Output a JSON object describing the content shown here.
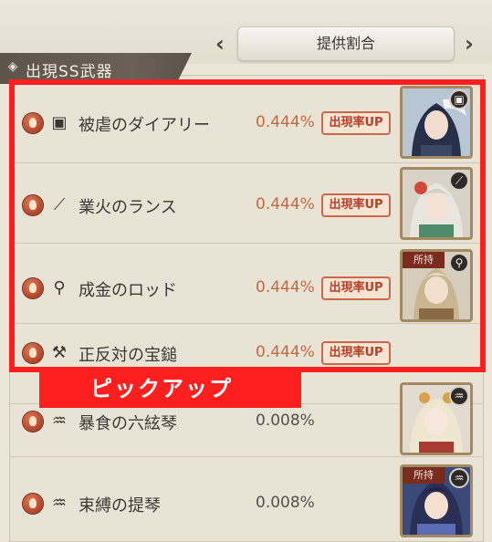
{
  "header": {
    "tab_label": "提供割合",
    "prev_icon": "chevron-left-icon",
    "next_icon": "chevron-right-icon"
  },
  "section": {
    "title": "出現SS武器",
    "icon": "diamond-icon"
  },
  "weapons": [
    {
      "name": "被虐のダイアリー",
      "rate": "0.444%",
      "badge": "出現率UP",
      "weapon_icon": "book-icon",
      "pickup": true,
      "portrait": true,
      "owned": false
    },
    {
      "name": "業火のランス",
      "rate": "0.444%",
      "badge": "出現率UP",
      "weapon_icon": "spear-icon",
      "pickup": true,
      "portrait": true,
      "owned": false
    },
    {
      "name": "成金のロッド",
      "rate": "0.444%",
      "badge": "出現率UP",
      "weapon_icon": "staff-icon",
      "pickup": true,
      "portrait": true,
      "owned": true
    },
    {
      "name": "正反対の宝鎚",
      "rate": "0.444%",
      "badge": "出現率UP",
      "weapon_icon": "hammer-icon",
      "pickup": true,
      "portrait": false,
      "owned": false
    },
    {
      "name": "暴食の六絃琴",
      "rate": "0.008%",
      "badge": "",
      "weapon_icon": "harp-icon",
      "pickup": false,
      "portrait": true,
      "owned": false
    },
    {
      "name": "束縛の提琴",
      "rate": "0.008%",
      "badge": "",
      "weapon_icon": "harp-icon",
      "pickup": false,
      "portrait": true,
      "owned": true
    }
  ],
  "owned_label": "所持",
  "pickup_label": "ピックアップ",
  "colors": {
    "highlight": "#ff1f1f",
    "rate_up": "#c06a44",
    "header_band": "#5d544b"
  }
}
